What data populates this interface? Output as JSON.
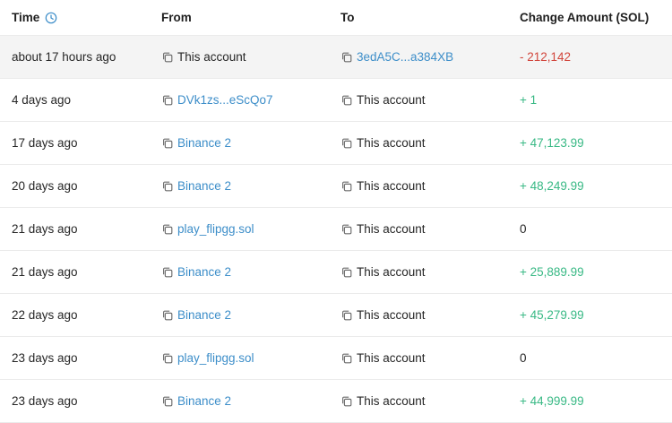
{
  "header": {
    "time": "Time",
    "from": "From",
    "to": "To",
    "amount": "Change Amount (SOL)"
  },
  "colors": {
    "link": "#3d8ec9",
    "positive": "#39b985",
    "negative": "#d1453b",
    "row_highlight": "#f4f4f4"
  },
  "rows": [
    {
      "time": "about 17 hours ago",
      "from": "This account",
      "to": "3edA5C...a384XB",
      "amount": "- 212,142"
    },
    {
      "time": "4 days ago",
      "from": "DVk1zs...eScQo7",
      "to": "This account",
      "amount": "+ 1"
    },
    {
      "time": "17 days ago",
      "from": "Binance 2",
      "to": "This account",
      "amount": "+ 47,123.99"
    },
    {
      "time": "20 days ago",
      "from": "Binance 2",
      "to": "This account",
      "amount": "+ 48,249.99"
    },
    {
      "time": "21 days ago",
      "from": "play_flipgg.sol",
      "to": "This account",
      "amount": "0"
    },
    {
      "time": "21 days ago",
      "from": "Binance 2",
      "to": "This account",
      "amount": "+ 25,889.99"
    },
    {
      "time": "22 days ago",
      "from": "Binance 2",
      "to": "This account",
      "amount": "+ 45,279.99"
    },
    {
      "time": "23 days ago",
      "from": "play_flipgg.sol",
      "to": "This account",
      "amount": "0"
    },
    {
      "time": "23 days ago",
      "from": "Binance 2",
      "to": "This account",
      "amount": "+ 44,999.99"
    }
  ]
}
